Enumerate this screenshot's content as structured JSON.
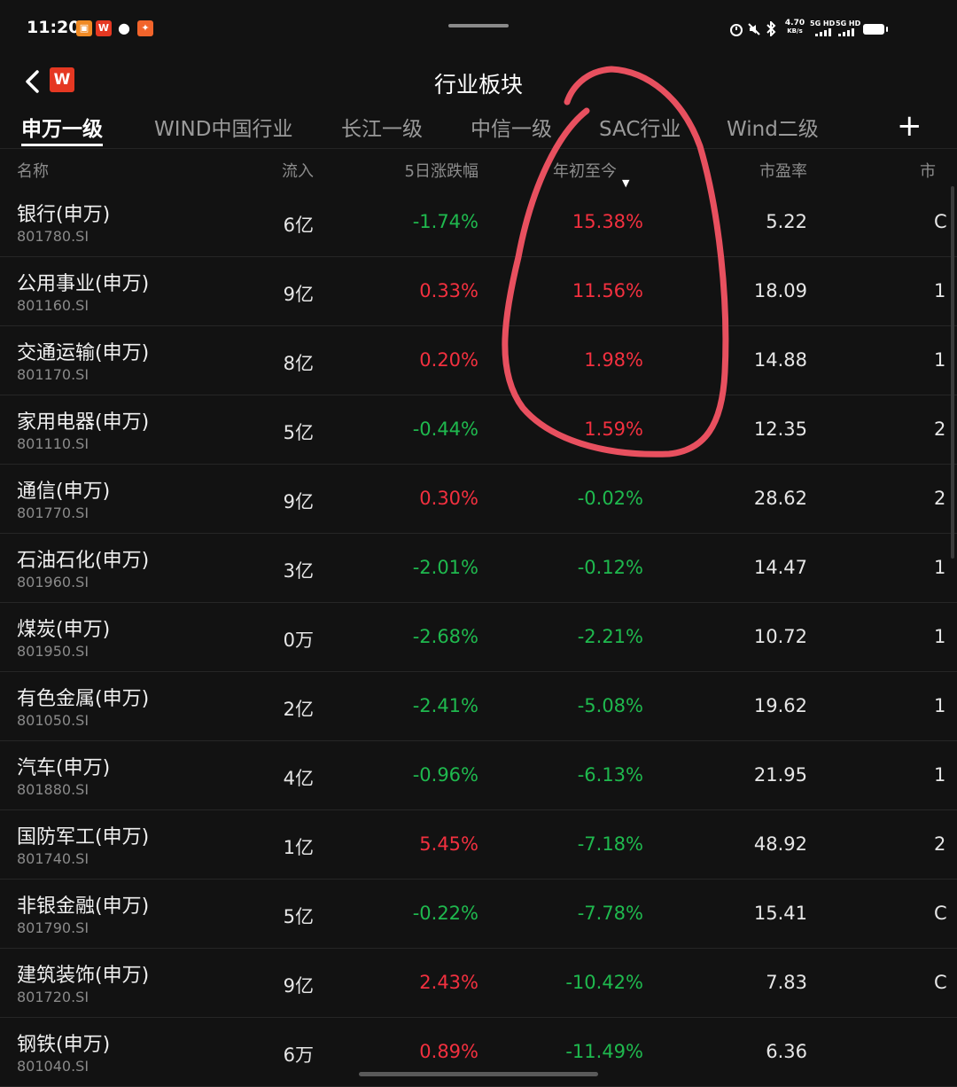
{
  "status_bar": {
    "time": "11:20",
    "network_speed_value": "4.70",
    "network_speed_unit": "KB/s",
    "signal_1": "5G HD",
    "signal_2": "5G HD",
    "notification_icons": [
      "app-notification-icon",
      "wps-icon",
      "message-bubble-icon",
      "shopping-app-icon"
    ],
    "system_icons": [
      "alarm-icon",
      "mute-icon",
      "bluetooth-icon",
      "signal-icon",
      "battery-icon"
    ]
  },
  "header": {
    "title": "行业板块",
    "logo_text": "W",
    "logo_color": "#e53822"
  },
  "tabs": [
    {
      "label": "申万一级",
      "active": true
    },
    {
      "label": "WIND中国行业",
      "active": false
    },
    {
      "label": "长江一级",
      "active": false
    },
    {
      "label": "中信一级",
      "active": false
    },
    {
      "label": "SAC行业",
      "active": false
    },
    {
      "label": "Wind二级",
      "active": false
    }
  ],
  "add_tab_label": "+",
  "columns": {
    "name": "名称",
    "inflow": "流入",
    "change_5d": "5日涨跌幅",
    "ytd": "年初至今",
    "pe": "市盈率",
    "extra": "市"
  },
  "sort": {
    "column": "ytd",
    "direction": "descending",
    "arrow": "▼"
  },
  "colors": {
    "background": "#121212",
    "up": "#f2303f",
    "down": "#1fb94e",
    "annotation": "#e8505f"
  },
  "rows": [
    {
      "name": "银行(申万)",
      "code": "801780.SI",
      "inflow": "6亿",
      "change_5d": "-1.74%",
      "ytd": "15.38%",
      "pe": "5.22",
      "extra": "C"
    },
    {
      "name": "公用事业(申万)",
      "code": "801160.SI",
      "inflow": "9亿",
      "change_5d": "0.33%",
      "ytd": "11.56%",
      "pe": "18.09",
      "extra": "1"
    },
    {
      "name": "交通运输(申万)",
      "code": "801170.SI",
      "inflow": "8亿",
      "change_5d": "0.20%",
      "ytd": "1.98%",
      "pe": "14.88",
      "extra": "1"
    },
    {
      "name": "家用电器(申万)",
      "code": "801110.SI",
      "inflow": "5亿",
      "change_5d": "-0.44%",
      "ytd": "1.59%",
      "pe": "12.35",
      "extra": "2"
    },
    {
      "name": "通信(申万)",
      "code": "801770.SI",
      "inflow": "9亿",
      "change_5d": "0.30%",
      "ytd": "-0.02%",
      "pe": "28.62",
      "extra": "2"
    },
    {
      "name": "石油石化(申万)",
      "code": "801960.SI",
      "inflow": "3亿",
      "change_5d": "-2.01%",
      "ytd": "-0.12%",
      "pe": "14.47",
      "extra": "1"
    },
    {
      "name": "煤炭(申万)",
      "code": "801950.SI",
      "inflow": "0万",
      "change_5d": "-2.68%",
      "ytd": "-2.21%",
      "pe": "10.72",
      "extra": "1"
    },
    {
      "name": "有色金属(申万)",
      "code": "801050.SI",
      "inflow": "2亿",
      "change_5d": "-2.41%",
      "ytd": "-5.08%",
      "pe": "19.62",
      "extra": "1"
    },
    {
      "name": "汽车(申万)",
      "code": "801880.SI",
      "inflow": "4亿",
      "change_5d": "-0.96%",
      "ytd": "-6.13%",
      "pe": "21.95",
      "extra": "1"
    },
    {
      "name": "国防军工(申万)",
      "code": "801740.SI",
      "inflow": "1亿",
      "change_5d": "5.45%",
      "ytd": "-7.18%",
      "pe": "48.92",
      "extra": "2"
    },
    {
      "name": "非银金融(申万)",
      "code": "801790.SI",
      "inflow": "5亿",
      "change_5d": "-0.22%",
      "ytd": "-7.78%",
      "pe": "15.41",
      "extra": "C"
    },
    {
      "name": "建筑装饰(申万)",
      "code": "801720.SI",
      "inflow": "9亿",
      "change_5d": "2.43%",
      "ytd": "-10.42%",
      "pe": "7.83",
      "extra": "C"
    },
    {
      "name": "钢铁(申万)",
      "code": "801040.SI",
      "inflow": "6万",
      "change_5d": "0.89%",
      "ytd": "-11.49%",
      "pe": "6.36",
      "extra": ""
    }
  ]
}
